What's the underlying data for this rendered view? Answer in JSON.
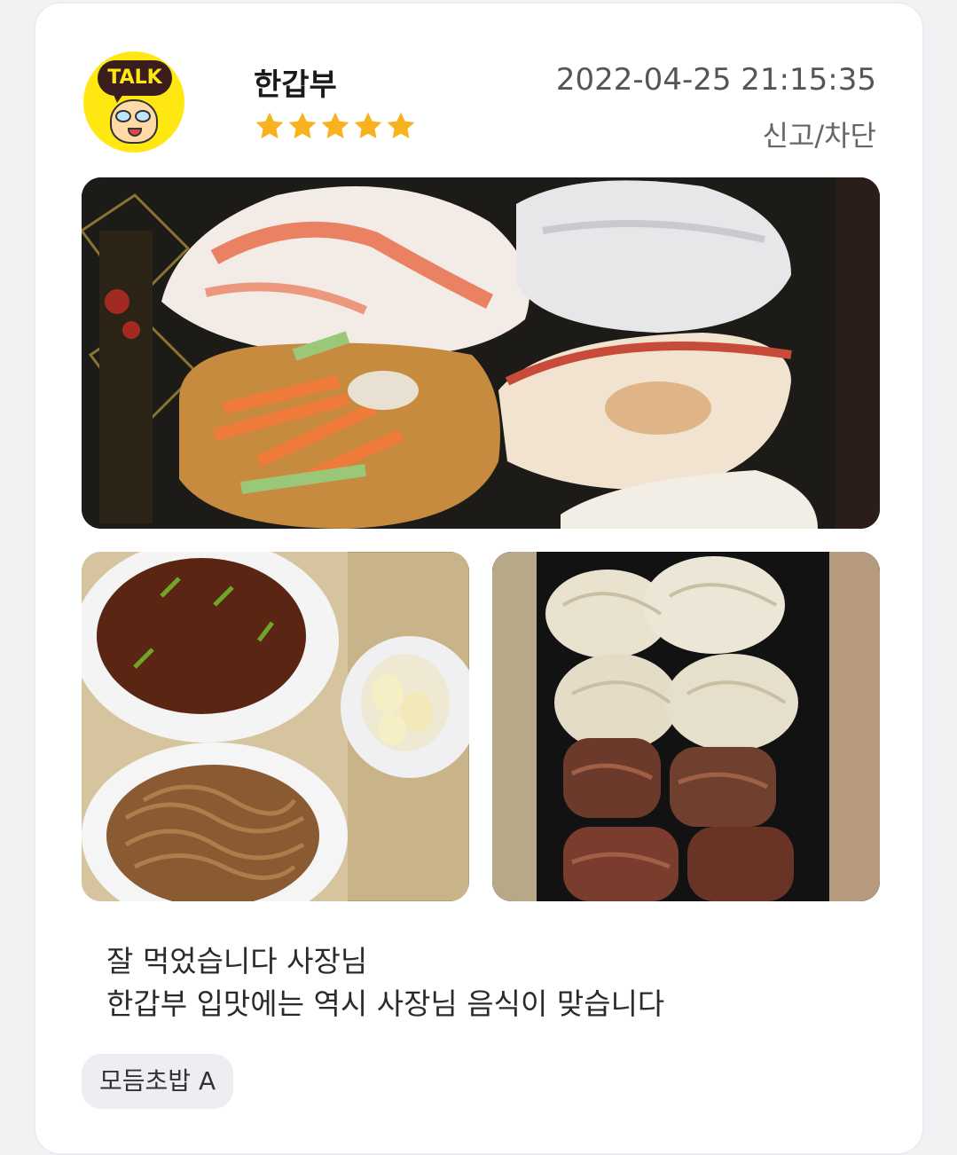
{
  "review": {
    "avatar_badge": "TALK",
    "username": "한갑부",
    "rating": 5,
    "date": "2022-04-25 21:15:35",
    "report_label": "신고/차단",
    "text_line1": "잘 먹었습니다 사장님",
    "text_line2": "한갑부 입맛에는 역시 사장님 음식이 맞습니다",
    "menu_tag": "모듬초밥 A"
  },
  "icons": {
    "star": "star-icon"
  },
  "colors": {
    "star": "#f7b21d",
    "avatar_bg": "#ffe812",
    "tag_bg": "#eeeef2"
  }
}
